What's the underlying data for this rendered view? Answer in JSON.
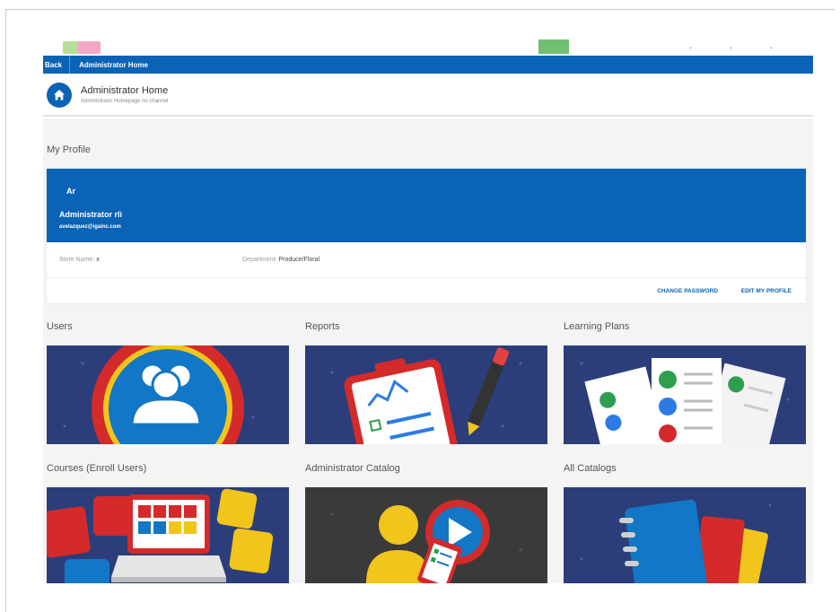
{
  "nav": {
    "back_label": "Back",
    "breadcrumb": "Administrator Home"
  },
  "header": {
    "title": "Administrator Home",
    "subtitle": "Administrator Homepage no channel",
    "icon": "home-icon"
  },
  "profile": {
    "section_title": "My Profile",
    "initials": "Ar",
    "name": "Administrator rli",
    "email": "avelazquez@igainc.com",
    "store_label": "Store Name:",
    "store_value": "x",
    "department_label": "Department:",
    "department_value": "Produce/Floral",
    "change_password": "CHANGE PASSWORD",
    "edit_profile": "EDIT MY PROFILE"
  },
  "tiles": [
    {
      "label": "Users",
      "icon": "users-icon"
    },
    {
      "label": "Reports",
      "icon": "reports-clipboard-icon"
    },
    {
      "label": "Learning Plans",
      "icon": "learning-plans-checklist-icon"
    },
    {
      "label": "Courses (Enroll Users)",
      "icon": "courses-laptop-icon"
    },
    {
      "label": "Administrator Catalog",
      "icon": "admin-catalog-play-icon"
    },
    {
      "label": "All Catalogs",
      "icon": "catalogs-binder-icon"
    }
  ],
  "colors": {
    "brand_blue": "#0a63b5",
    "tile_navy": "#2c3e7a",
    "tile_dark": "#3a3a3a"
  }
}
